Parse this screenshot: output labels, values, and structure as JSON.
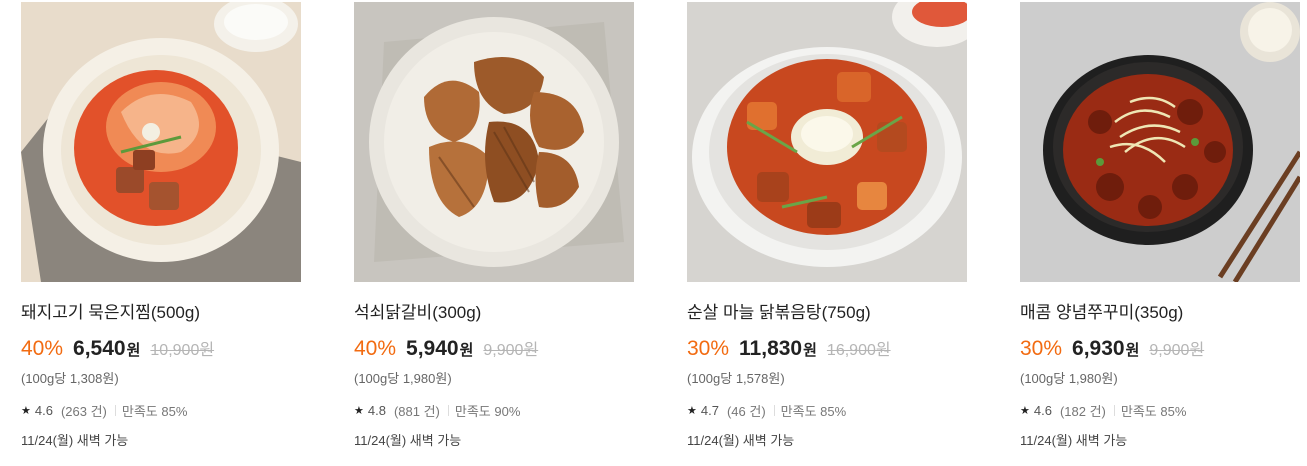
{
  "products": [
    {
      "name": "돼지고기 묵은지찜(500g)",
      "discount": "40%",
      "price": "6,540",
      "currency": "원",
      "original_price": "10,900원",
      "unit_price": "(100g당 1,308원)",
      "rating": "4.6",
      "reviews": "(263 건)",
      "satisfaction": "만족도 85%",
      "delivery": "11/24(월) 새벽 가능",
      "image_icon": "braised-kimchi-pork-photo",
      "bg": "#e9dccb"
    },
    {
      "name": "석쇠닭갈비(300g)",
      "discount": "40%",
      "price": "5,940",
      "currency": "원",
      "original_price": "9,900원",
      "unit_price": "(100g당 1,980원)",
      "rating": "4.8",
      "reviews": "(881 건)",
      "satisfaction": "만족도 90%",
      "delivery": "11/24(월) 새벽 가능",
      "image_icon": "grilled-chicken-galbi-photo",
      "bg": "#c9c6c0"
    },
    {
      "name": "순살 마늘 닭볶음탕(750g)",
      "discount": "30%",
      "price": "11,830",
      "currency": "원",
      "original_price": "16,900원",
      "unit_price": "(100g당 1,578원)",
      "rating": "4.7",
      "reviews": "(46 건)",
      "satisfaction": "만족도 85%",
      "delivery": "11/24(월) 새벽 가능",
      "image_icon": "garlic-braised-chicken-photo",
      "bg": "#d8d6d2"
    },
    {
      "name": "매콤 양념쭈꾸미(350g)",
      "discount": "30%",
      "price": "6,930",
      "currency": "원",
      "original_price": "9,900원",
      "unit_price": "(100g당 1,980원)",
      "rating": "4.6",
      "reviews": "(182 건)",
      "satisfaction": "만족도 85%",
      "delivery": "11/24(월) 새벽 가능",
      "image_icon": "spicy-webfoot-octopus-photo",
      "bg": "#cfcfcf"
    }
  ],
  "colors": {
    "discount": "#f26b11",
    "text": "#222222",
    "muted": "#b5b5b5"
  }
}
